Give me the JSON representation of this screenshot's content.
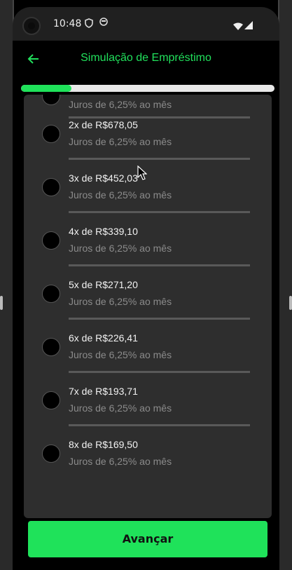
{
  "status_bar": {
    "time": "10:48"
  },
  "header": {
    "title": "Simulação de Empréstimo"
  },
  "progress": {
    "fraction": 0.2
  },
  "options": [
    {
      "title": "",
      "subtitle": "Juros de 6,25% ao mês"
    },
    {
      "title": "2x de R$678,05",
      "subtitle": "Juros de 6,25% ao mês"
    },
    {
      "title": "3x de R$452,03",
      "subtitle": "Juros de 6,25% ao mês"
    },
    {
      "title": "4x de R$339,10",
      "subtitle": "Juros de 6,25% ao mês"
    },
    {
      "title": "5x de R$271,20",
      "subtitle": "Juros de 6,25% ao mês"
    },
    {
      "title": "6x de R$226,41",
      "subtitle": "Juros de 6,25% ao mês"
    },
    {
      "title": "7x de R$193,71",
      "subtitle": "Juros de 6,25% ao mês"
    },
    {
      "title": "8x de R$169,50",
      "subtitle": "Juros de 6,25% ao mês"
    }
  ],
  "footer": {
    "button_label": "Avançar"
  },
  "colors": {
    "accent": "#1fe25a",
    "card": "#2e2e2e",
    "muted_text": "#8b8b8b"
  }
}
